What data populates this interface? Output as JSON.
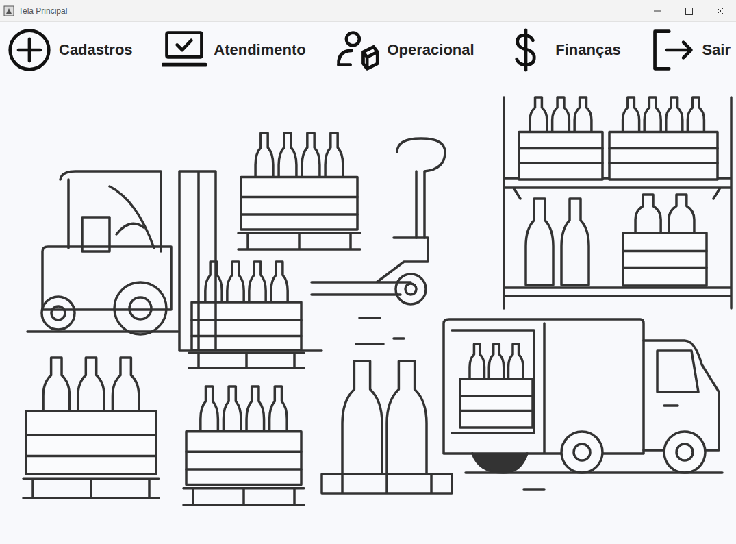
{
  "window": {
    "title": "Tela Principal"
  },
  "menu": [
    {
      "label": "Cadastros"
    },
    {
      "label": "Atendimento"
    },
    {
      "label": "Operacional"
    },
    {
      "label": "Finanças"
    },
    {
      "label": "Sair"
    }
  ]
}
